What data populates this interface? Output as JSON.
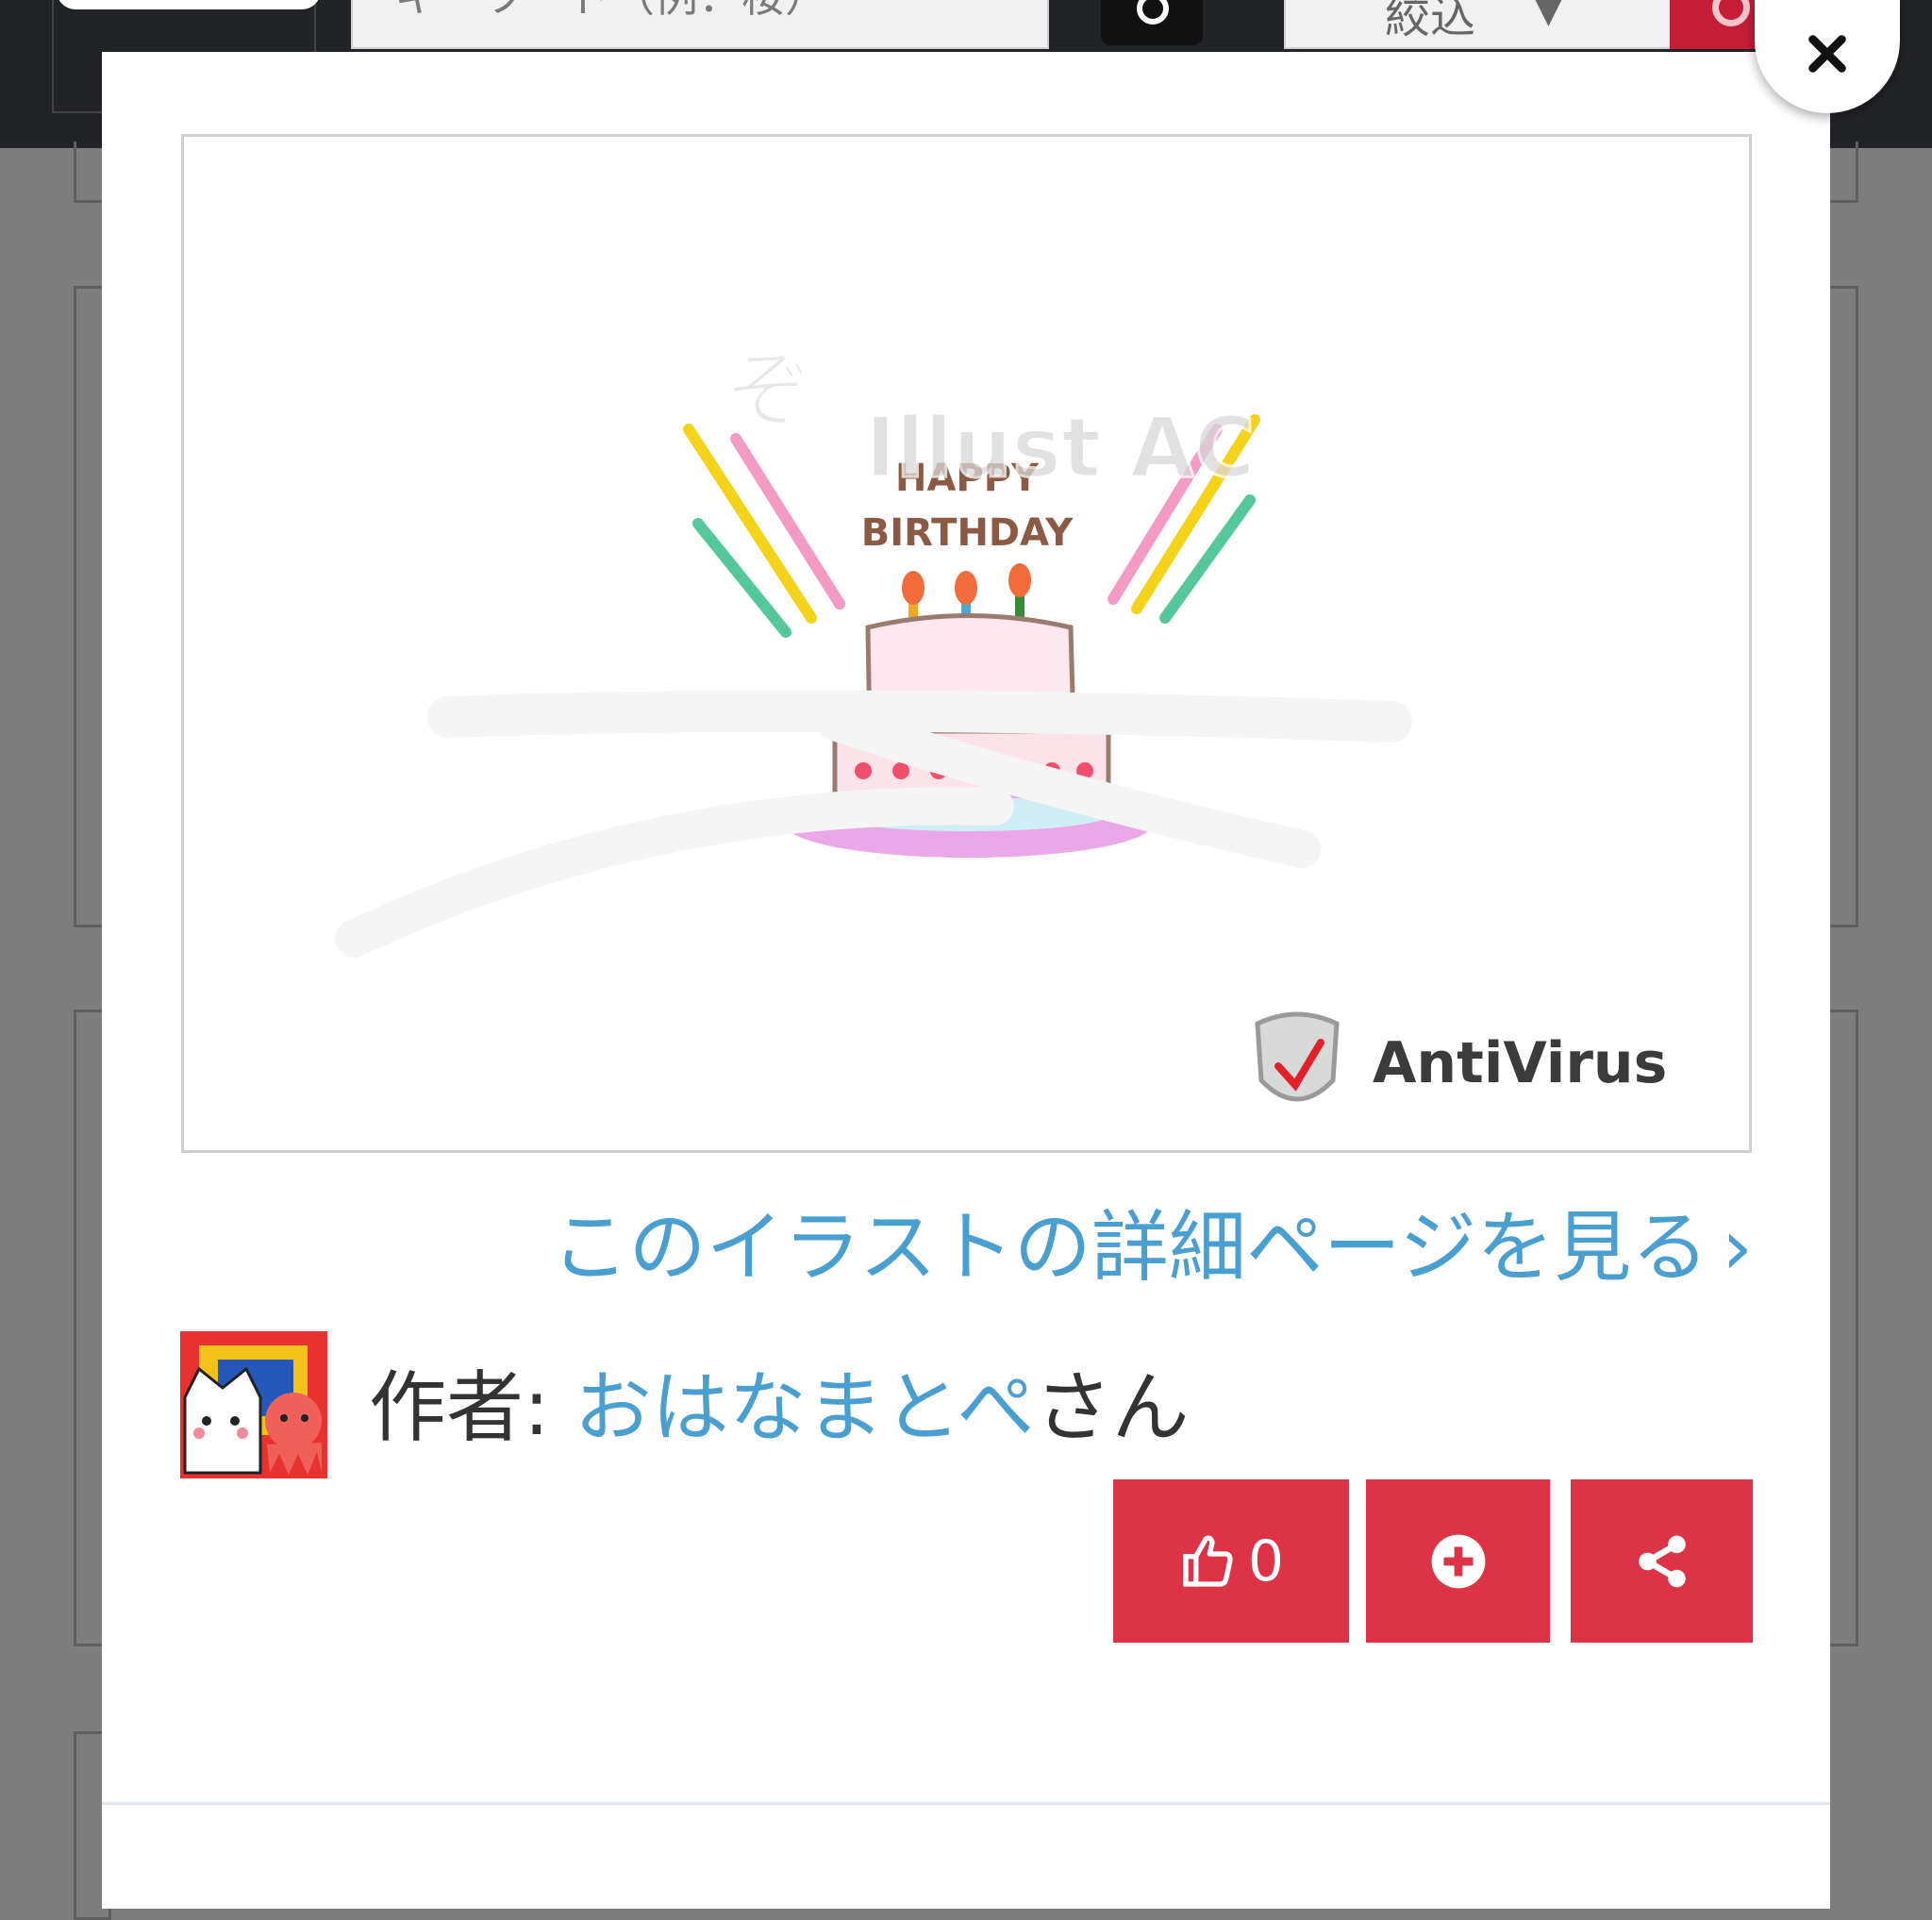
{
  "header": {
    "search_placeholder": "キーワード（例：桜）",
    "filter_label": "絞込",
    "filter_caret": "▼"
  },
  "modal": {
    "close_label": "×",
    "preview": {
      "image_text_line1": "HAPPY",
      "image_text_line2": "BIRTHDAY",
      "watermark": "Illust AC",
      "badge_text": "AntiVirus"
    },
    "detail_link_label": "このイラストの詳細ページを見る",
    "detail_link_chevron": "›",
    "author_prefix": "作者: ",
    "author_name": "おはなまとぺ",
    "author_suffix": "さん",
    "like_count": "0",
    "colors": {
      "accent": "#dc3446",
      "link": "#4a9fd1",
      "overlay": "#7d7d7d"
    }
  }
}
